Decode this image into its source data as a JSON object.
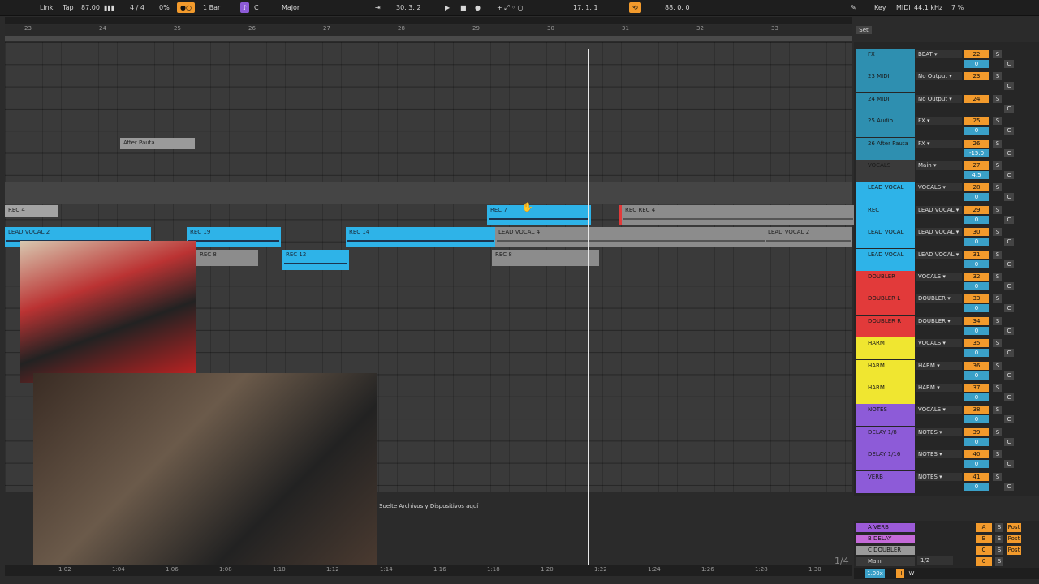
{
  "transport": {
    "link": "Link",
    "tap": "Tap",
    "tempo": "87.00",
    "signature": "4 / 4",
    "cpu": "0%",
    "quantize": "1 Bar",
    "key": "C",
    "scale": "Major",
    "position": "30.  3.  2",
    "loop_start": "17.  1.  1",
    "loop_len": "88.  0.  0",
    "key_label": "Key",
    "midi_label": "MIDI",
    "sample_rate": "44.1 kHz",
    "load": "7 %"
  },
  "ruler": {
    "bars": [
      "23",
      "24",
      "25",
      "26",
      "27",
      "28",
      "29",
      "30",
      "31",
      "32",
      "33"
    ],
    "set_label": "Set"
  },
  "time_marks": [
    "1:02",
    "1:04",
    "1:06",
    "1:08",
    "1:10",
    "1:12",
    "1:14",
    "1:16",
    "1:18",
    "1:20",
    "1:22",
    "1:24",
    "1:26",
    "1:28",
    "1:30"
  ],
  "clips": [
    {
      "name": "After Pauta"
    },
    {
      "name": "REC 4"
    },
    {
      "name": "REC 7"
    },
    {
      "name": "REC REC 4"
    },
    {
      "name": "LEAD VOCAL 2"
    },
    {
      "name": "REC 19"
    },
    {
      "name": "REC 14"
    },
    {
      "name": "LEAD VOCAL 4"
    },
    {
      "name": "LEAD VOCAL 2"
    },
    {
      "name": "REC 8"
    },
    {
      "name": "REC 12"
    },
    {
      "name": "REC 8"
    }
  ],
  "drop_hint": "Suelte Archivos y Dispositivos aquí",
  "tracks": [
    {
      "name": "FX",
      "io": "BEAT",
      "num": "22",
      "vol": "0",
      "color": "#2e8fb0"
    },
    {
      "name": "23 MIDI",
      "io": "No Output",
      "num": "23",
      "vol": "",
      "color": "#2e8fb0"
    },
    {
      "name": "24 MIDI",
      "io": "No Output",
      "num": "24",
      "vol": "",
      "color": "#2e8fb0"
    },
    {
      "name": "25 Audio",
      "io": "FX",
      "num": "25",
      "vol": "0",
      "color": "#2e8fb0"
    },
    {
      "name": "26 After Pauta",
      "io": "FX",
      "num": "26",
      "vol": "-15.0",
      "color": "#2e8fb0"
    },
    {
      "name": "VOCALS",
      "io": "Main",
      "num": "27",
      "vol": "4.5",
      "color": "#3a3a3a"
    },
    {
      "name": "LEAD VOCAL",
      "io": "VOCALS",
      "num": "28",
      "vol": "0",
      "color": "#2eb3e8"
    },
    {
      "name": "REC",
      "io": "LEAD VOCAL",
      "num": "29",
      "vol": "0",
      "color": "#2eb3e8"
    },
    {
      "name": "LEAD VOCAL",
      "io": "LEAD VOCAL",
      "num": "30",
      "vol": "0",
      "color": "#2eb3e8"
    },
    {
      "name": "LEAD VOCAL",
      "io": "LEAD VOCAL",
      "num": "31",
      "vol": "0",
      "color": "#2eb3e8"
    },
    {
      "name": "DOUBLER",
      "io": "VOCALS",
      "num": "32",
      "vol": "0",
      "color": "#e23a3a"
    },
    {
      "name": "DOUBLER L",
      "io": "DOUBLER",
      "num": "33",
      "vol": "0",
      "color": "#e23a3a"
    },
    {
      "name": "DOUBLER R",
      "io": "DOUBLER",
      "num": "34",
      "vol": "0",
      "color": "#e23a3a"
    },
    {
      "name": "HARM",
      "io": "VOCALS",
      "num": "35",
      "vol": "0",
      "color": "#f0e630"
    },
    {
      "name": "HARM",
      "io": "HARM",
      "num": "36",
      "vol": "0",
      "color": "#f0e630"
    },
    {
      "name": "HARM",
      "io": "HARM",
      "num": "37",
      "vol": "0",
      "color": "#f0e630"
    },
    {
      "name": "NOTES",
      "io": "VOCALS",
      "num": "38",
      "vol": "0",
      "color": "#8d5bd8"
    },
    {
      "name": "DELAY 1/8",
      "io": "NOTES",
      "num": "39",
      "vol": "0",
      "color": "#8d5bd8"
    },
    {
      "name": "DELAY 1/16",
      "io": "NOTES",
      "num": "40",
      "vol": "0",
      "color": "#8d5bd8"
    },
    {
      "name": "VERB",
      "io": "NOTES",
      "num": "41",
      "vol": "0",
      "color": "#8d5bd8"
    }
  ],
  "returns": [
    {
      "name": "A VERB",
      "label": "A",
      "post": "Post",
      "color": "#9c5ad8"
    },
    {
      "name": "B DELAY",
      "label": "B",
      "post": "Post",
      "color": "#c46ad8"
    },
    {
      "name": "C DOUBLER",
      "label": "C",
      "post": "Post",
      "color": "#9a9a9a"
    },
    {
      "name": "Main",
      "label": "0",
      "post": "",
      "color": "#3a3a3a"
    }
  ],
  "footer": {
    "zoom": "1.00x",
    "page": "1/4",
    "main_io": "1/2",
    "h": "H",
    "w": "W"
  }
}
